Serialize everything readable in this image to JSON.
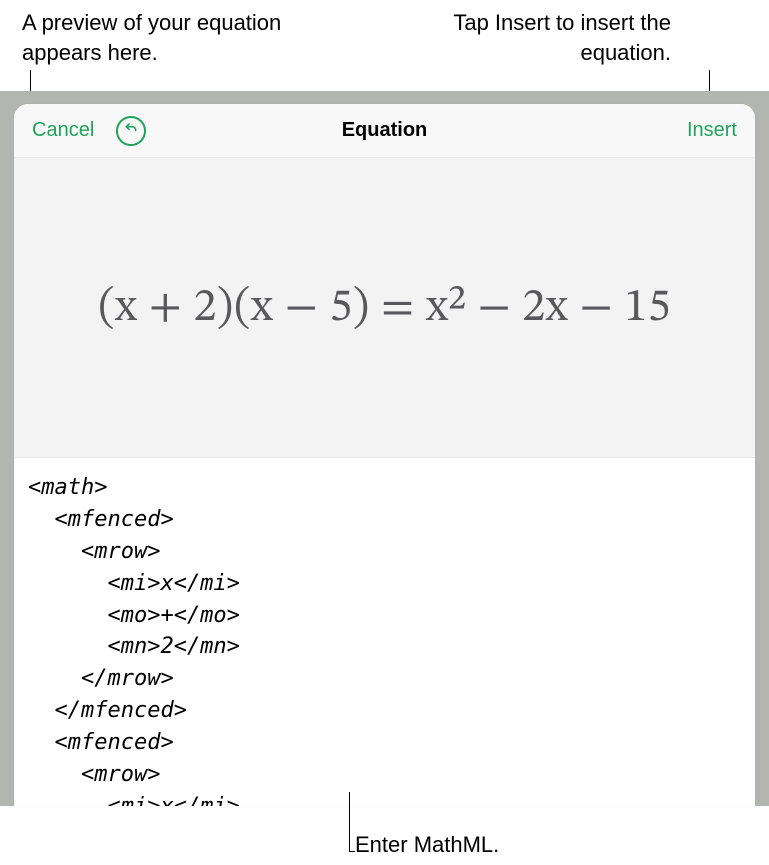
{
  "callouts": {
    "preview": "A preview of your equation appears here.",
    "insert": "Tap Insert to insert the equation.",
    "enter": "Enter MathML."
  },
  "toolbar": {
    "cancel_label": "Cancel",
    "title": "Equation",
    "insert_label": "Insert"
  },
  "equation_preview": "(x + 2)(x − 5) = x² − 2x − 15",
  "mathml_source": "<math>\n  <mfenced>\n    <mrow>\n      <mi>x</mi>\n      <mo>+</mo>\n      <mn>2</mn>\n    </mrow>\n  </mfenced>\n  <mfenced>\n    <mrow>\n      <mi>x</mi>\n      <mo>-</mo>"
}
